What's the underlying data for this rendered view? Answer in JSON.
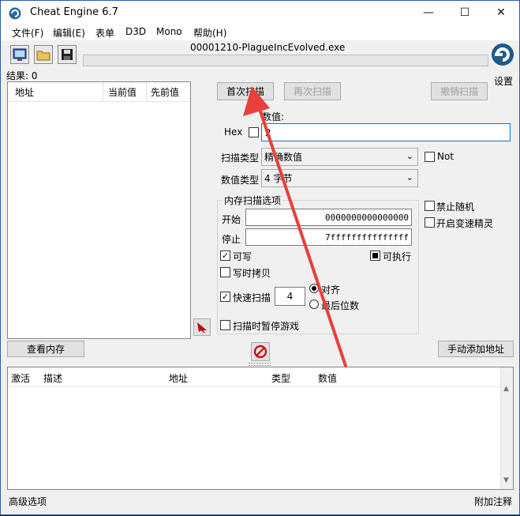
{
  "window": {
    "title": "Cheat Engine 6.7",
    "process": "00001210-PlagueIncEvolved.exe",
    "min_symbol": "—",
    "max_symbol": "☐",
    "close_symbol": "✕"
  },
  "menu": [
    "文件(F)",
    "编辑(E)",
    "表单",
    "D3D",
    "Mono",
    "帮助(H)"
  ],
  "results_label": "结果: 0",
  "settings_label": "设置",
  "results_table": {
    "headers": [
      "地址",
      "当前值",
      "先前值"
    ]
  },
  "scan_buttons": {
    "first": "首次扫描",
    "next": "再次扫描",
    "undo": "撤销扫描"
  },
  "value": {
    "label": "数值:",
    "hex_label": "Hex",
    "current": "2"
  },
  "scan_type": {
    "label": "扫描类型",
    "selected": "精确数值"
  },
  "value_type": {
    "label": "数值类型",
    "selected": "4 字节"
  },
  "not_label": "Not",
  "mem_options": {
    "title": "内存扫描选项",
    "start_label": "开始",
    "start_value": "0000000000000000",
    "stop_label": "停止",
    "stop_value": "7fffffffffffffff",
    "writable": "可写",
    "executable": "可执行",
    "copy_on_write": "写时拷贝",
    "fast_scan": "快速扫描",
    "fast_value": "4",
    "align": "对齐",
    "last_digits": "最后位数",
    "pause_game": "扫描时暂停游戏"
  },
  "right_options": {
    "disable_random": "禁止随机",
    "speedhack": "开启变速精灵"
  },
  "view_memory": "查看内存",
  "add_address": "手动添加地址",
  "address_list": {
    "headers": [
      "激活",
      "描述",
      "地址",
      "类型",
      "数值"
    ]
  },
  "status": {
    "left": "高级选项",
    "right": "附加注释"
  },
  "colors": {
    "arrow": "#e8403a",
    "titlebar": "#ffffff",
    "accent": "#0078d7"
  },
  "icons": [
    "cheat-engine-logo-icon",
    "open-process-icon",
    "open-file-icon",
    "save-icon",
    "pointer-arrow-icon",
    "stop-scan-icon"
  ]
}
